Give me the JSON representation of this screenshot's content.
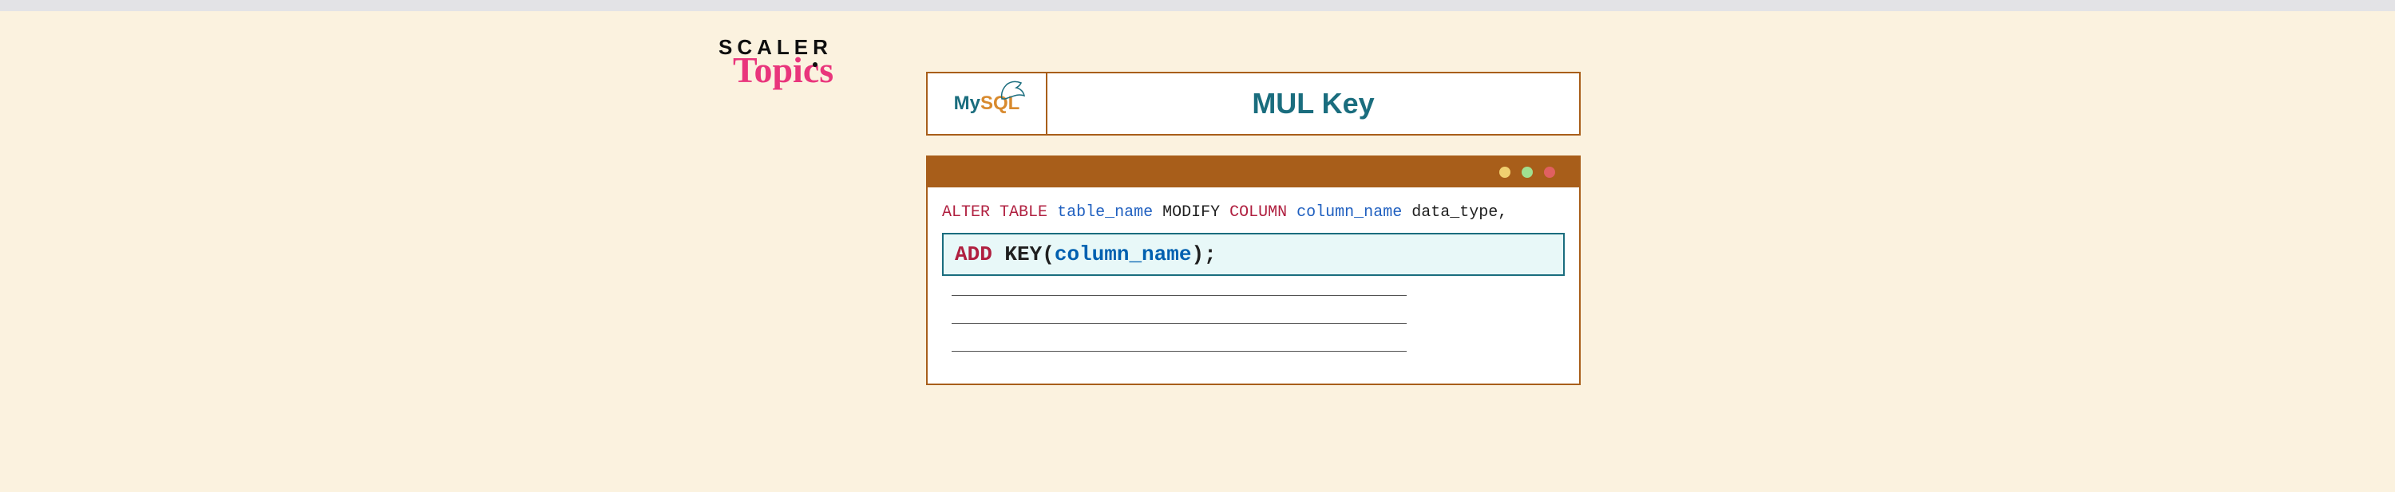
{
  "logo": {
    "line1": "SCALER",
    "line2": "Topics"
  },
  "header": {
    "mysql_my": "My",
    "mysql_sql": "SQL",
    "title": "MUL Key"
  },
  "code": {
    "alter": "ALTER",
    "table": "TABLE",
    "table_name": "table_name",
    "modify": "MODIFY",
    "column": "COLUMN",
    "column_name": "column_name",
    "data_type": "data_type",
    "comma": ",",
    "add": "ADD",
    "key_open": "KEY(",
    "col2": "column_name",
    "close": ");"
  }
}
